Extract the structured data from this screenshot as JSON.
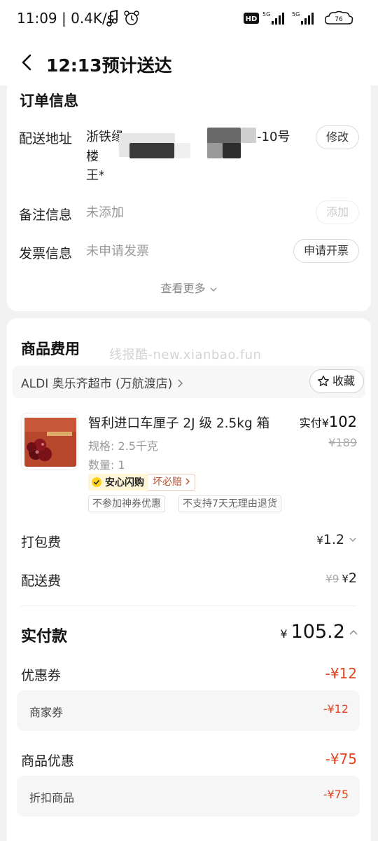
{
  "status_bar": {
    "time": "11:09 | 0.4K/s",
    "network_1": "5G",
    "network_2": "5G",
    "battery": "76"
  },
  "nav": {
    "title": "12:13预计送达",
    "back_icon": "chevron-left-icon"
  },
  "order_info": {
    "title": "订单信息",
    "address_label": "配送地址",
    "address_line1_start": "浙铁缘",
    "address_line1_end": "-10号",
    "address_line2": "楼",
    "address_line3": "王*",
    "edit_button": "修改",
    "note_label": "备注信息",
    "note_value": "未添加",
    "note_button": "添加",
    "invoice_label": "发票信息",
    "invoice_value": "未申请发票",
    "invoice_button": "申请开票",
    "see_more": "查看更多"
  },
  "fees": {
    "title": "商品费用",
    "watermark": "线报酷-new.xianbao.fun",
    "store_name": "ALDI 奥乐齐超市 (万航渡店)",
    "favorite_button": "收藏",
    "product": {
      "name": "智利进口车厘子 2J 级 2.5kg 箱",
      "spec": "规格: 2.5千克",
      "qty": "数量: 1",
      "paid_label": "实付",
      "paid_currency": "¥",
      "paid_amount": "102",
      "original_price": "¥189",
      "badge_main": "安心闪购",
      "badge_sub": "坏必赔",
      "tag_1": "不参加神券优惠",
      "tag_2": "不支持7天无理由退货"
    },
    "packing_label": "打包费",
    "packing_currency": "¥",
    "packing_value": "1.2",
    "delivery_label": "配送费",
    "delivery_original": "¥9",
    "delivery_currency": "¥",
    "delivery_value": "2",
    "total_label": "实付款",
    "total_currency": "¥",
    "total_value": "105.2",
    "coupon_label": "优惠券",
    "coupon_value": "-¥12",
    "merchant_coupon_label": "商家券",
    "merchant_coupon_value": "-¥12",
    "product_discount_label": "商品优惠",
    "product_discount_value": "-¥75",
    "discount_item_label": "折扣商品",
    "discount_item_value": "-¥75"
  },
  "colors": {
    "accent_red": "#e1441e",
    "badge_yellow": "#ffd21a"
  }
}
